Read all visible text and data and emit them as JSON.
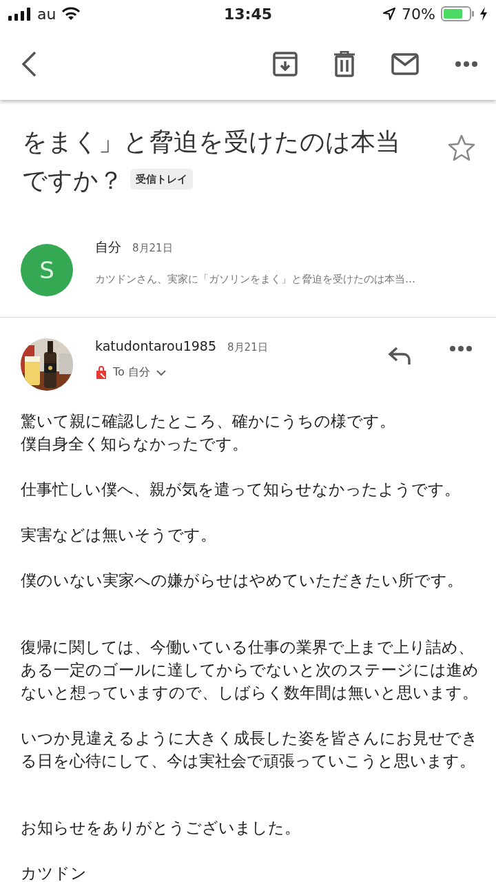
{
  "status_bar": {
    "carrier": "au",
    "time": "13:45",
    "battery": "70%"
  },
  "subject_lines": [
    "をまく」と脅迫を受けたのは本当",
    "ですか？"
  ],
  "label": "受信トレイ",
  "starred": false,
  "messages": [
    {
      "kind": "collapsed",
      "avatar_letter": "S",
      "sender": "自分",
      "date": "8月21日",
      "snippet": "カツドンさん、実家に「ガソリンをまく」と脅迫を受けたのは本当…"
    },
    {
      "kind": "expanded",
      "avatar": {
        "kind": "picture"
      },
      "sender": "katudontarou1985",
      "date": "8月21日",
      "recipient": "To 自分",
      "body": [
        [
          [
            "驚いて親に確認したところ、確かにうちの様です。",
            "僕自身全く知らなかったです。"
          ],
          [
            "仕事忙しい僕へ、親が気を遣って知らせなかったようです。"
          ],
          [
            "実害などは無いそうです。"
          ],
          [
            "僕のいない実家への嫌がらせはやめていただきたい所です。"
          ]
        ],
        [
          [
            "復帰に関しては、今働いている仕事の業界で上まで上り詰め、ある一定のゴールに達してからでないと次のステージには進めないと想っていますので、しばらく数年間は無いと思います。"
          ],
          [
            "いつか見違えるように大きく成長した姿を皆さんにお見せできる日を心待にして、今は実社会で頑張っていこうと思います。"
          ]
        ],
        [
          [
            "お知らせをありがとうございました。"
          ],
          [
            "カツドン"
          ]
        ]
      ]
    }
  ]
}
